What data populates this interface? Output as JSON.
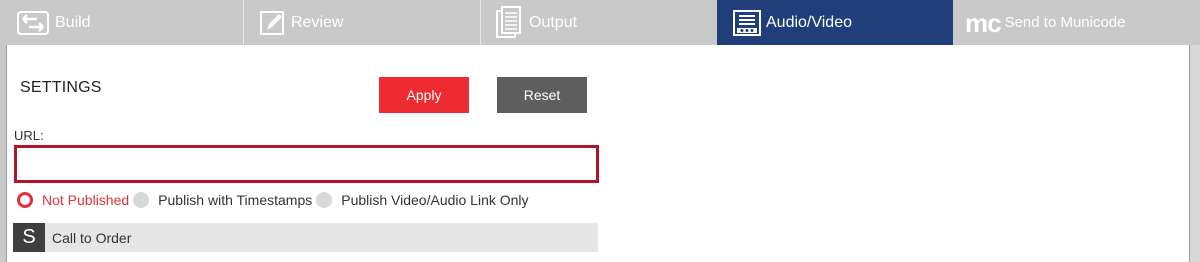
{
  "tabs": [
    {
      "label": "Build",
      "icon": "build-arrows-icon",
      "active": false
    },
    {
      "label": "Review",
      "icon": "pencil-icon",
      "active": false
    },
    {
      "label": "Output",
      "icon": "documents-icon",
      "active": false
    },
    {
      "label": "Audio/Video",
      "icon": "media-player-icon",
      "active": true
    },
    {
      "label": "Send to Municode",
      "logo": "mc",
      "icon": "municode-logo-icon",
      "active": false
    }
  ],
  "settings": {
    "title": "SETTINGS",
    "apply_label": "Apply",
    "reset_label": "Reset",
    "url_label": "URL:",
    "url_value": "",
    "url_placeholder": ""
  },
  "publish_options": [
    {
      "label": "Not Published",
      "selected": true
    },
    {
      "label": "Publish with Timestamps",
      "selected": false
    },
    {
      "label": "Publish Video/Audio Link Only",
      "selected": false
    }
  ],
  "agenda": {
    "badge": "S",
    "item_label": "Call to Order"
  },
  "colors": {
    "active_tab": "#1f3e7a",
    "apply": "#ee2b31",
    "reset": "#5e5e5e",
    "input_border": "#b0152f",
    "selected_radio": "#e5303a"
  }
}
